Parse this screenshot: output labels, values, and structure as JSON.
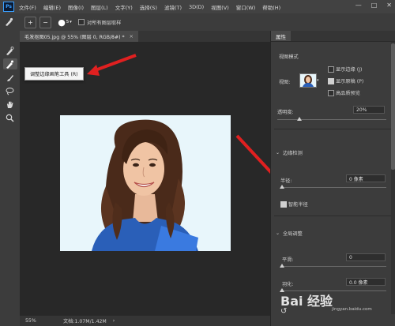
{
  "menubar": {
    "logo": "Ps",
    "items": [
      "文件(F)",
      "编辑(E)",
      "图像(I)",
      "图层(L)",
      "文字(Y)",
      "选择(S)",
      "滤镜(T)",
      "3D(D)",
      "视图(V)",
      "窗口(W)",
      "帮助(H)"
    ],
    "window_controls": [
      "—",
      "□",
      "✕"
    ]
  },
  "options_bar": {
    "brush_size": "5",
    "sample_all_layers_label": "对所有图层取样"
  },
  "document": {
    "tab_title": "毛发抠图05.jpg @ 55% (图层 0, RGB/8#) *",
    "tab_close": "×",
    "zoom": "55%",
    "doc_info": "文档:1.07M/1.42M"
  },
  "tooltip": {
    "text": "调整边缘画笔工具 (R)"
  },
  "properties_panel": {
    "tab_label": "属性",
    "view_mode_label": "视图模式",
    "view_label": "视图:",
    "show_edge_label": "显示边缘 (J)",
    "show_original_label": "显示原稿 (P)",
    "high_quality_preview_label": "高品质预览",
    "show_edge_checked": false,
    "show_original_checked": true,
    "high_quality_checked": false,
    "transparency_label": "透明度:",
    "transparency_value": "20%",
    "transparency_level": 0.2,
    "edge_detection_label": "边缘检测",
    "radius_label": "半径:",
    "radius_value": "0 像素",
    "radius_level": 0.0,
    "smart_radius_label": "智能半径",
    "smart_radius_checked": true,
    "global_refinement_label": "全局调整",
    "smooth_label": "平滑:",
    "smooth_value": "0",
    "smooth_level": 0.0,
    "feather_label": "羽化:",
    "feather_value": "0.0 像素",
    "feather_level": 0.0
  },
  "watermark": {
    "text": "Bai 经验",
    "sub": "jingyan.baidu.com"
  },
  "colors": {
    "accent": "#3aa0ff",
    "arrow_red": "#e02020"
  }
}
